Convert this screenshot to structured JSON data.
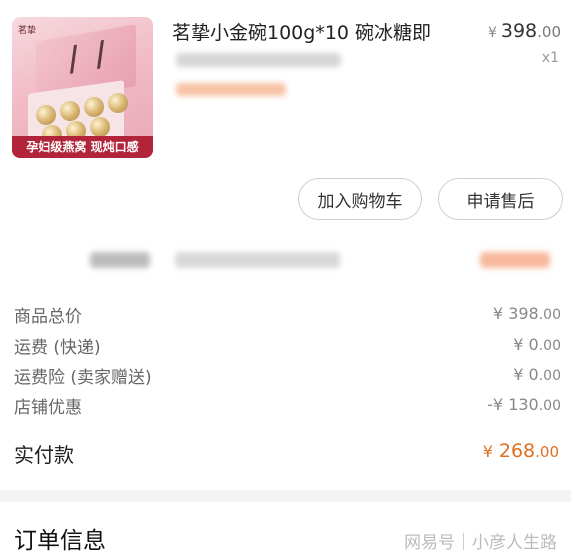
{
  "product": {
    "image_alt": "茗挚",
    "promo": "孕妇级燕窝 现炖口感",
    "title": "茗挚小金碗100g*10 碗冰糖即",
    "price_currency": "¥",
    "price_int": "398",
    "price_dec": ".00",
    "qty": "x1"
  },
  "actions": {
    "add_to_cart": "加入购物车",
    "after_sales": "申请售后"
  },
  "fees": [
    {
      "label": "商品总价",
      "currency": "¥",
      "int": "398",
      "dec": ".00"
    },
    {
      "label": "运费 (快递)",
      "currency": "¥",
      "int": "0",
      "dec": ".00"
    },
    {
      "label": "运费险 (卖家赠送)",
      "currency": "¥",
      "int": "0",
      "dec": ".00"
    },
    {
      "label": "店铺优惠",
      "currency": "-¥",
      "int": "130",
      "dec": ".00"
    }
  ],
  "total": {
    "label": "实付款",
    "currency": "¥",
    "int": "268",
    "dec": ".00"
  },
  "order_info": {
    "title": "订单信息"
  },
  "watermark": {
    "left": "网易号",
    "right": "小彦人生路"
  },
  "colors": {
    "accent": "#e07020",
    "promo_banner": "#b2243a"
  }
}
